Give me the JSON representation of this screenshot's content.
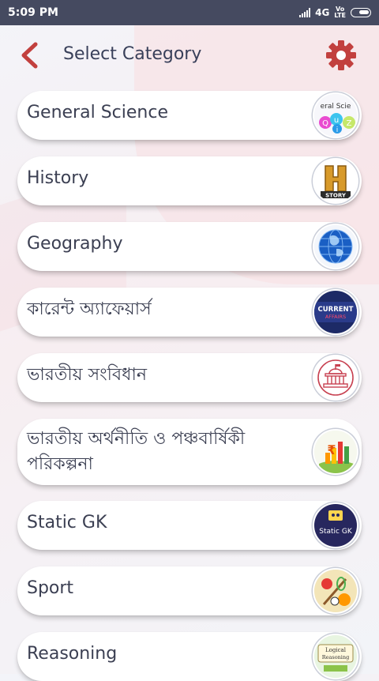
{
  "status_bar": {
    "time": "5:09 PM",
    "network": "4G",
    "volte_top": "Vo",
    "volte_bottom": "LTE"
  },
  "header": {
    "title": "Select Category",
    "accent_color": "#c2403e",
    "settings_color": "#c2403e"
  },
  "categories": [
    {
      "label": "General Science",
      "icon": "general-science-quiz-icon",
      "icon_text": "eral Scie"
    },
    {
      "label": "History",
      "icon": "history-channel-icon",
      "icon_text": "STORY"
    },
    {
      "label": "Geography",
      "icon": "globe-icon"
    },
    {
      "label": "কারেন্ট অ্যাফেয়ার্স",
      "icon": "current-affairs-icon",
      "icon_text_1": "CURRENT",
      "icon_text_2": "AFFAIRS"
    },
    {
      "label": "ভারতীয় সংবিধান",
      "icon": "parliament-building-icon"
    },
    {
      "label_line1": "ভারতীয় অর্থনীতি ও পঞ্চবার্ষিকী",
      "label_line2": "পরিকল্পনা",
      "icon": "rupee-economy-icon"
    },
    {
      "label": "Static GK",
      "icon": "static-gk-icon",
      "icon_text": "Static GK"
    },
    {
      "label": "Sport",
      "icon": "sports-equipment-icon"
    },
    {
      "label": "Reasoning",
      "icon": "logical-reasoning-icon",
      "icon_text": "Logical Reasoning"
    }
  ]
}
